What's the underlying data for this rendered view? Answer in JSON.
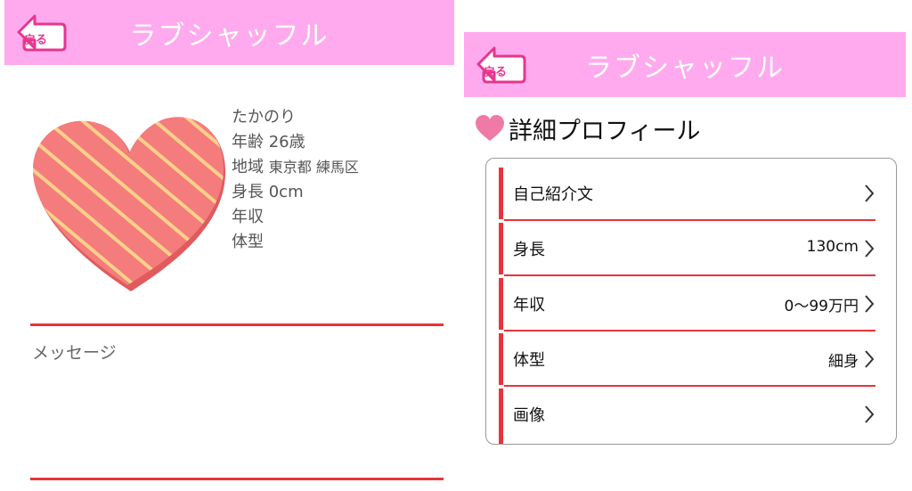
{
  "left": {
    "header": {
      "title": "ラブシャッフル",
      "back_label": "戻る"
    },
    "profile": {
      "name": "たかのり",
      "age_label": "年齢",
      "age_value": "26歳",
      "area_label": "地域",
      "area_value": "東京都 練馬区",
      "height_label": "身長",
      "height_value": "0cm",
      "income_label": "年収",
      "body_label": "体型"
    },
    "message_label": "メッセージ"
  },
  "right": {
    "header": {
      "title": "ラブシャッフル",
      "back_label": "戻る"
    },
    "section_title": "詳細プロフィール",
    "rows": [
      {
        "label": "自己紹介文",
        "value": ""
      },
      {
        "label": "身長",
        "value": "130cm"
      },
      {
        "label": "年収",
        "value": "0〜99万円"
      },
      {
        "label": "体型",
        "value": "細身"
      },
      {
        "label": "画像",
        "value": ""
      }
    ]
  },
  "colors": {
    "header_bg": "#ffaaee",
    "accent_red": "#e8343a",
    "heart_pink": "#f07aa6"
  },
  "icons": [
    "back-arrow-icon",
    "heart-icon",
    "chevron-right-icon"
  ]
}
